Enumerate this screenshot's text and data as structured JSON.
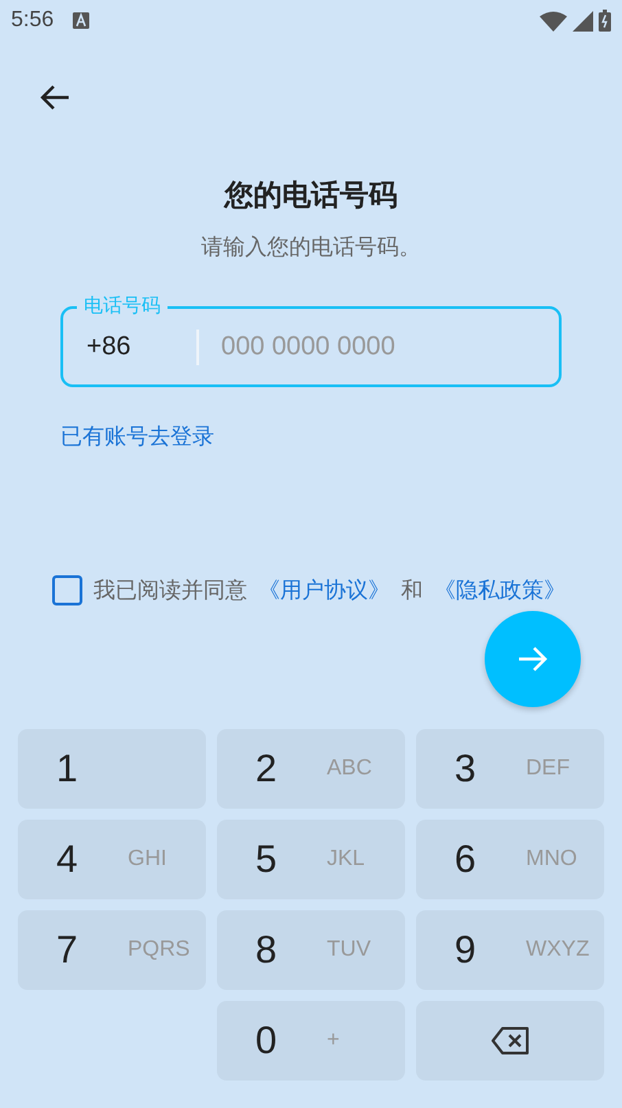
{
  "status_bar": {
    "time": "5:56"
  },
  "title": "您的电话号码",
  "subtitle": "请输入您的电话号码。",
  "phone_field": {
    "label": "电话号码",
    "country_code": "+86",
    "placeholder": "000 0000 0000"
  },
  "login_link": "已有账号去登录",
  "agreement": {
    "checked": false,
    "prefix": "我已阅读并同意",
    "terms_link": "《用户协议》",
    "joiner": "和",
    "privacy_link": "《隐私政策》"
  },
  "keypad": [
    {
      "kind": "digit",
      "digit": "1"
    },
    {
      "kind": "digit",
      "digit": "2",
      "letters": "ABC"
    },
    {
      "kind": "digit",
      "digit": "3",
      "letters": "DEF"
    },
    {
      "kind": "digit",
      "digit": "4",
      "letters": "GHI"
    },
    {
      "kind": "digit",
      "digit": "5",
      "letters": "JKL"
    },
    {
      "kind": "digit",
      "digit": "6",
      "letters": "MNO"
    },
    {
      "kind": "digit",
      "digit": "7",
      "letters": "PQRS"
    },
    {
      "kind": "digit",
      "digit": "8",
      "letters": "TUV"
    },
    {
      "kind": "digit",
      "digit": "9",
      "letters": "WXYZ"
    },
    {
      "kind": "blank"
    },
    {
      "kind": "digit",
      "digit": "0",
      "letters": "+"
    },
    {
      "kind": "backspace"
    }
  ]
}
